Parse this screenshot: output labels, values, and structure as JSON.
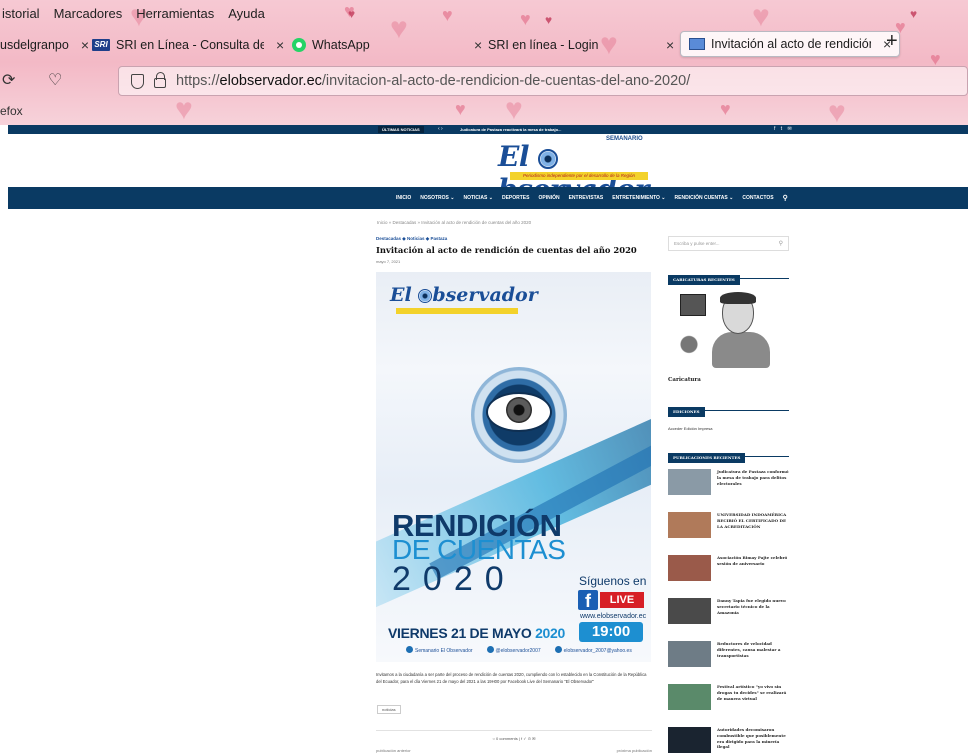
{
  "browser": {
    "menu": [
      "istorial",
      "Marcadores",
      "Herramientas",
      "Ayuda"
    ],
    "tabs": [
      {
        "label": "usdelgranpo",
        "icon": "none"
      },
      {
        "label": "SRI en Línea - Consulta de estad",
        "icon": "sri-icon"
      },
      {
        "label": "WhatsApp",
        "icon": "whatsapp-icon"
      },
      {
        "label": "SRI en línea - Login",
        "icon": "none"
      },
      {
        "label": "Invitación al acto de rendición d",
        "icon": "page-icon",
        "active": true
      }
    ],
    "sri_badge": "SRI",
    "close_glyph": "×",
    "new_tab_glyph": "+",
    "url_scheme": "https://",
    "url_host": "elobservador.ec",
    "url_path": "/invitacion-al-acto-de-rendicion-de-cuentas-del-ano-2020/",
    "bookmark_fragment": "efox"
  },
  "site": {
    "top_strip": {
      "label": "ÚLTIMAS NOTICIAS",
      "arrows": "‹  ›",
      "ticker": "Judicatura de Pastaza reactivará la mesa de trabajo...",
      "socials": "f  t  ✉"
    },
    "logo": {
      "semanario": "SEMANARIO",
      "brand_pre": "El ",
      "brand_post": "bservador",
      "tagline": "Periodismo independiente por el desarrollo de la Región"
    },
    "nav": [
      "Inicio",
      "Nosotros ⌄",
      "Noticias ⌄",
      "Deportes",
      "Opinión",
      "Entrevistas",
      "Entretenimiento ⌄",
      "Rendición Cuentas ⌄",
      "Contactos"
    ],
    "nav_search_glyph": "⚲",
    "breadcrumb": "Inicio   »   Destacadas   »   Invitación al acto de rendición de cuentas del año 2020"
  },
  "article": {
    "categories": "Destacadas  ◆  Noticias  ◆  Pastaza",
    "title": "Invitación al acto de rendición de cuentas del año 2020",
    "date": "mayo 7, 2021",
    "poster": {
      "brand_pre": "El ",
      "brand_post": "bservador",
      "line1": "RENDICIÓN",
      "line2": "DE CUENTAS",
      "year": "2020",
      "siguenos": "Síguenos en",
      "fb": "f",
      "live": "LIVE",
      "site": "www.elobservador.ec",
      "date_pre": "VIERNES 21 DE MAYO ",
      "date_year": "2020",
      "time": "19:00",
      "socials": [
        "Semanario El Observador",
        "@elobservador2007",
        "elobservador_2007@yahoo.es"
      ]
    },
    "body": "Invitamos a la ciudadanía a ser parte del proceso de rendición de cuentas 2020, cumpliendo con lo establecido en la Constitución de la República del Ecuador, para el día Viernes 21 de mayo del 2021 a las 19H00 por Facebook Live del Semanario \"El Observador\"",
    "tag": "noticias",
    "share": "○ 0 comments   |   f  ✓  ⊙  ✉",
    "prev_label": "publicación anterior",
    "next_label": "próxima publicación"
  },
  "sidebar": {
    "search_placeholder": "Escriba y pulse enter...",
    "search_glyph": "⚲",
    "cartoons_heading": "CARICATURAS RECIENTES",
    "cartoon_label": "Caricatura",
    "ediciones_heading": "EDICIONES",
    "edicion_link": "Acceder Edición Impresa",
    "recent_heading": "PUBLICACIONES RECIENTES",
    "recent": [
      {
        "title": "Judicatura de Pastaza conformó la mesa de trabajo para delitos electorales",
        "color": "#8a9aa6"
      },
      {
        "title": "UNIVERSIDAD INDOAMÉRICA RECIBIÓ EL CERTIFICADO DE LA ACREDITACIÓN",
        "color": "#b07a5a"
      },
      {
        "title": "Asociación Rimay Pajte celebró sesión de aniversario",
        "color": "#9a5a4a"
      },
      {
        "title": "Danny Tapia fue elegido nuevo secretario técnico de la Amazonía",
        "color": "#4a4a4a"
      },
      {
        "title": "Reductores de velocidad diferentes, causa malestar a transportistas",
        "color": "#6e7c86"
      },
      {
        "title": "Festival artístico \"yo vivo sin drogas tu decides\" se realizará de manera virtual",
        "color": "#5a8a6a"
      },
      {
        "title": "Autoridades decomisaron combustible que posiblemente era dirigido para la minería ilegal",
        "color": "#1a2430"
      }
    ]
  }
}
